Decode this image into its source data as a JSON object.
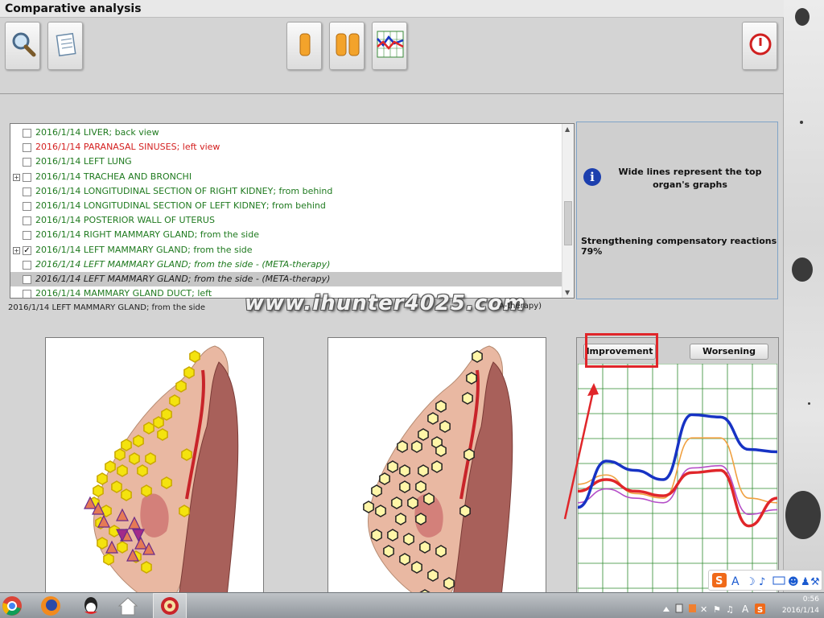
{
  "window": {
    "title": "Comparative analysis"
  },
  "toolbar": {
    "buttons": [
      {
        "name": "search-button",
        "icon": "magnifier-icon"
      },
      {
        "name": "notes-button",
        "icon": "notepad-icon"
      },
      {
        "name": "single-view-button",
        "icon": "single-bar-icon"
      },
      {
        "name": "double-view-button",
        "icon": "double-bar-icon"
      },
      {
        "name": "graph-view-button",
        "icon": "line-graph-icon"
      },
      {
        "name": "exit-button",
        "icon": "power-icon"
      }
    ]
  },
  "records": [
    {
      "date": "2016/1/14",
      "label": "LIVER; back view",
      "color": "#1f7a1f",
      "checked": false,
      "expandable": false,
      "italic": false,
      "selected": false
    },
    {
      "date": "2016/1/14",
      "label": "PARANASAL SINUSES; left view",
      "color": "#d42020",
      "checked": false,
      "expandable": false,
      "italic": false,
      "selected": false
    },
    {
      "date": "2016/1/14",
      "label": "LEFT LUNG",
      "color": "#1f7a1f",
      "checked": false,
      "expandable": false,
      "italic": false,
      "selected": false
    },
    {
      "date": "2016/1/14",
      "label": "TRACHEA AND BRONCHI",
      "color": "#1f7a1f",
      "checked": false,
      "expandable": true,
      "italic": false,
      "selected": false
    },
    {
      "date": "2016/1/14",
      "label": "LONGITUDINAL SECTION OF RIGHT KIDNEY; from behind",
      "color": "#1f7a1f",
      "checked": false,
      "expandable": false,
      "italic": false,
      "selected": false
    },
    {
      "date": "2016/1/14",
      "label": "LONGITUDINAL SECTION OF LEFT KIDNEY; from behind",
      "color": "#1f7a1f",
      "checked": false,
      "expandable": false,
      "italic": false,
      "selected": false
    },
    {
      "date": "2016/1/14",
      "label": "POSTERIOR WALL OF UTERUS",
      "color": "#1f7a1f",
      "checked": false,
      "expandable": false,
      "italic": false,
      "selected": false
    },
    {
      "date": "2016/1/14",
      "label": "RIGHT MAMMARY GLAND; from the side",
      "color": "#1f7a1f",
      "checked": false,
      "expandable": false,
      "italic": false,
      "selected": false
    },
    {
      "date": "2016/1/14",
      "label": "LEFT MAMMARY GLAND; from the side",
      "color": "#1f7a1f",
      "checked": true,
      "expandable": true,
      "italic": false,
      "selected": false
    },
    {
      "date": "2016/1/14",
      "label": "LEFT MAMMARY GLAND; from the side - (META-therapy)",
      "color": "#1f7a1f",
      "checked": false,
      "expandable": false,
      "italic": true,
      "selected": false
    },
    {
      "date": "2016/1/14",
      "label": "LEFT MAMMARY GLAND; from the side - (META-therapy)",
      "color": "#222222",
      "checked": false,
      "expandable": false,
      "italic": true,
      "selected": true
    },
    {
      "date": "2016/1/14",
      "label": "MAMMARY GLAND DUCT; left",
      "color": "#1f7a1f",
      "checked": false,
      "expandable": false,
      "italic": false,
      "selected": false
    }
  ],
  "selected_record": "2016/1/14  LEFT  MAMMARY  GLAND; from the side",
  "watermark": {
    "text": "www.ihunter4025.com",
    "tail": "A-therapy)"
  },
  "info": {
    "message": "Wide lines represent the top organ's graphs",
    "reactions": "Strengthening compensatory reactions 79%"
  },
  "graph": {
    "tabs": {
      "improvement": "Improvement",
      "worsening": "Worsening"
    },
    "active_tab": "Improvement",
    "colors": {
      "blue": "#1733c4",
      "red": "#e0262a",
      "orange": "#f0a040",
      "magenta": "#b54fc8",
      "grid": "#2d8a2d"
    },
    "series": [
      {
        "color_key": "blue",
        "wide": true,
        "values": [
          38,
          58,
          54,
          50,
          78,
          77,
          63,
          62
        ]
      },
      {
        "color_key": "red",
        "wide": true,
        "values": [
          45,
          50,
          45,
          43,
          53,
          54,
          30,
          42
        ]
      },
      {
        "color_key": "orange",
        "wide": false,
        "values": [
          48,
          52,
          44,
          42,
          68,
          68,
          42,
          40
        ]
      },
      {
        "color_key": "magenta",
        "wide": false,
        "values": [
          40,
          46,
          42,
          40,
          55,
          56,
          35,
          37
        ]
      }
    ]
  },
  "taskbar": {
    "apps": [
      "chrome-icon",
      "firefox-icon",
      "qq-icon",
      "home-icon",
      "app-target-icon"
    ],
    "time": "0:56",
    "date": "2016/1/14"
  }
}
